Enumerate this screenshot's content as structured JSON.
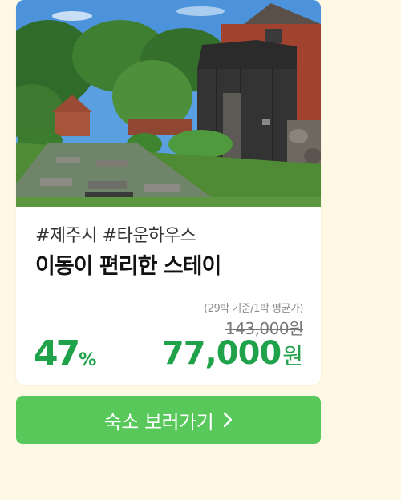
{
  "card": {
    "tags": "#제주시 #타운하우스",
    "title": "이동이 편리한 스테이",
    "price_basis": "(29박 기준/1박 평균가)",
    "original_price": "143,000원",
    "discount_percent": "47",
    "discount_suffix": "%",
    "sale_price": "77,000",
    "currency": "원"
  },
  "cta": {
    "label": "숙소 보러가기",
    "icon": "chevron-right-icon"
  },
  "colors": {
    "background": "#fff8e5",
    "accent_green": "#1fa24a",
    "button_green": "#58c85a"
  }
}
